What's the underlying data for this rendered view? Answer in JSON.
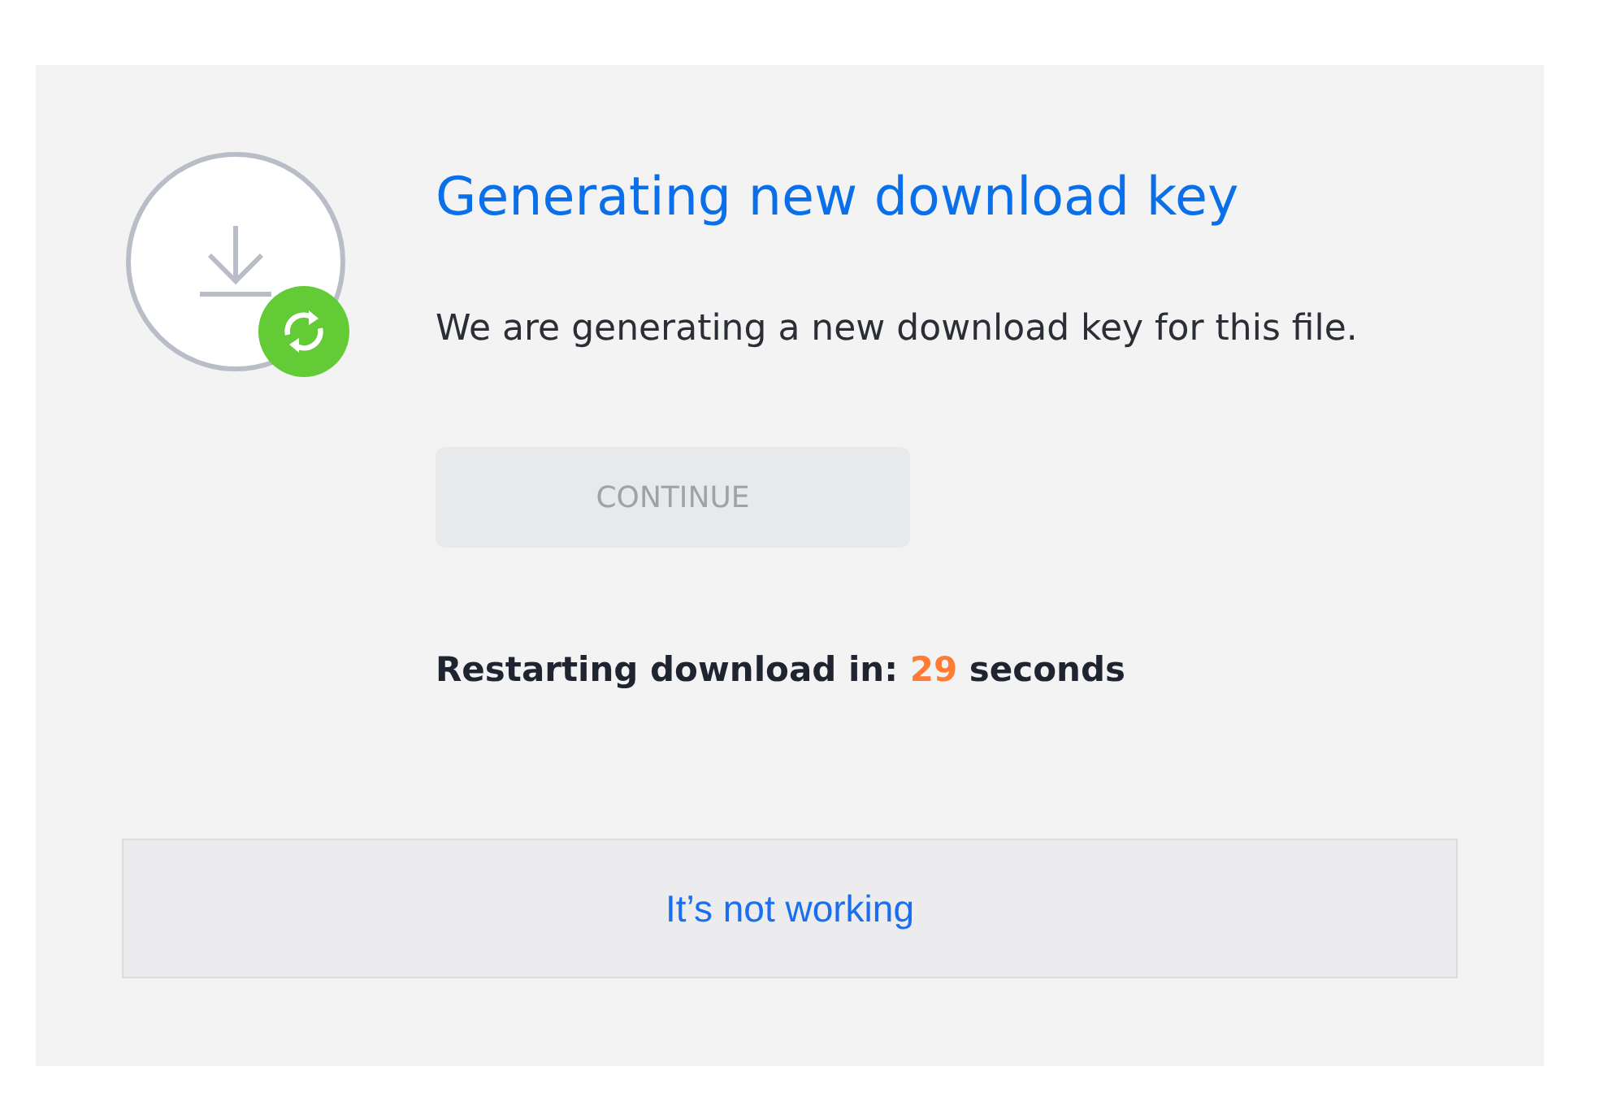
{
  "title": "Generating new download key",
  "description": "We are generating a new download key for this file.",
  "continue_button": {
    "label": "CONTINUE",
    "disabled": true
  },
  "countdown": {
    "prefix": "Restarting download in:",
    "seconds": "29",
    "suffix": "seconds"
  },
  "help_link": {
    "label": "It’s not working"
  }
}
